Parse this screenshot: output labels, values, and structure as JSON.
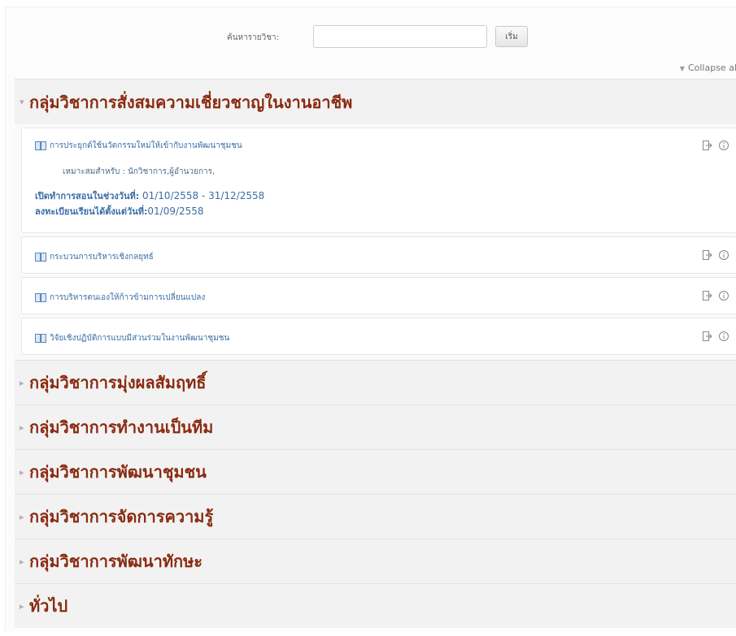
{
  "search": {
    "label": "ค้นหารายวิชา:",
    "input_value": "",
    "button_label": "เริ่ม"
  },
  "collapse_all": {
    "label": "Collapse al"
  },
  "categories": [
    {
      "title": "กลุ่มวิชาการสั่งสมความเชี่ยวชาญในงานอาชีพ",
      "state": "expanded",
      "courses": [
        {
          "name": "การประยุกต์ใช้นวัตกรรมใหม่ให้เข้ากับงานพัฒนาชุมชน",
          "suitable": "เหมาะสมสำหรับ : นักวิชาการ,ผู้อำนวยการ,",
          "teach_label": "เปิดทำการสอนในช่วงวันที่:",
          "teach_value": "01/10/2558 - 31/12/2558",
          "register_label": "ลงทะเบียนเรียนได้ตั้งแต่วันที่:",
          "register_value": "01/09/2558"
        },
        {
          "name": "กระบวนการบริหารเชิงกลยุทธ์"
        },
        {
          "name": "การบริหารตนเองให้ก้าวข้ามการเปลี่ยนแปลง"
        },
        {
          "name": "วิจัยเชิงปฏิบัติการแบบมีส่วนร่วมในงานพัฒนาชุมชน"
        }
      ]
    },
    {
      "title": "กลุ่มวิชาการมุ่งผลสัมฤทธิ์",
      "state": "collapsed"
    },
    {
      "title": "กลุ่มวิชาการทำงานเป็นทีม",
      "state": "collapsed"
    },
    {
      "title": "กลุ่มวิชาการพัฒนาชุมชน",
      "state": "collapsed"
    },
    {
      "title": "กลุ่มวิชาการจัดการความรู้",
      "state": "collapsed"
    },
    {
      "title": "กลุ่มวิชาการพัฒนาทักษะ",
      "state": "collapsed"
    },
    {
      "title": "ทั่วไป",
      "state": "collapsed"
    }
  ],
  "icons": {
    "expanded": "triangle-down-icon",
    "collapsed": "triangle-right-icon",
    "course": "book-icon",
    "enrol": "enrol-icon",
    "info": "info-icon"
  },
  "colors": {
    "category_title": "#8a2a10",
    "course_link": "#3b6ea5",
    "header_bg": "#f2f2f2"
  }
}
